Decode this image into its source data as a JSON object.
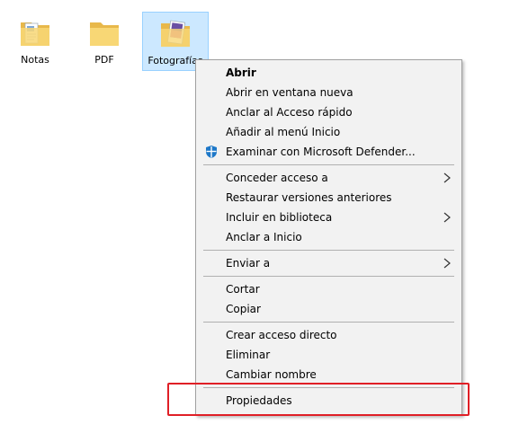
{
  "desktop": {
    "folders": [
      {
        "label": "Notas",
        "icon": "folder-documents-icon"
      },
      {
        "label": "PDF",
        "icon": "folder-icon"
      },
      {
        "label": "Fotografías",
        "icon": "folder-pictures-icon",
        "selected": true
      }
    ]
  },
  "context_menu": {
    "items": [
      {
        "label": "Abrir",
        "bold": true
      },
      {
        "label": "Abrir en ventana nueva"
      },
      {
        "label": "Anclar al Acceso rápido"
      },
      {
        "label": "Añadir al menú Inicio"
      },
      {
        "label": "Examinar con Microsoft Defender...",
        "icon": "defender-shield-icon"
      },
      {
        "label": "Conceder acceso a",
        "submenu": true
      },
      {
        "label": "Restaurar versiones anteriores"
      },
      {
        "label": "Incluir en biblioteca",
        "submenu": true
      },
      {
        "label": "Anclar a Inicio"
      },
      {
        "label": "Enviar a",
        "submenu": true
      },
      {
        "label": "Cortar"
      },
      {
        "label": "Copiar"
      },
      {
        "label": "Crear acceso directo"
      },
      {
        "label": "Eliminar"
      },
      {
        "label": "Cambiar nombre"
      },
      {
        "label": "Propiedades"
      }
    ]
  },
  "colors": {
    "highlight_box": "#e01f26",
    "selection_fill": "#cce8ff",
    "menu_background": "#f2f2f2"
  }
}
